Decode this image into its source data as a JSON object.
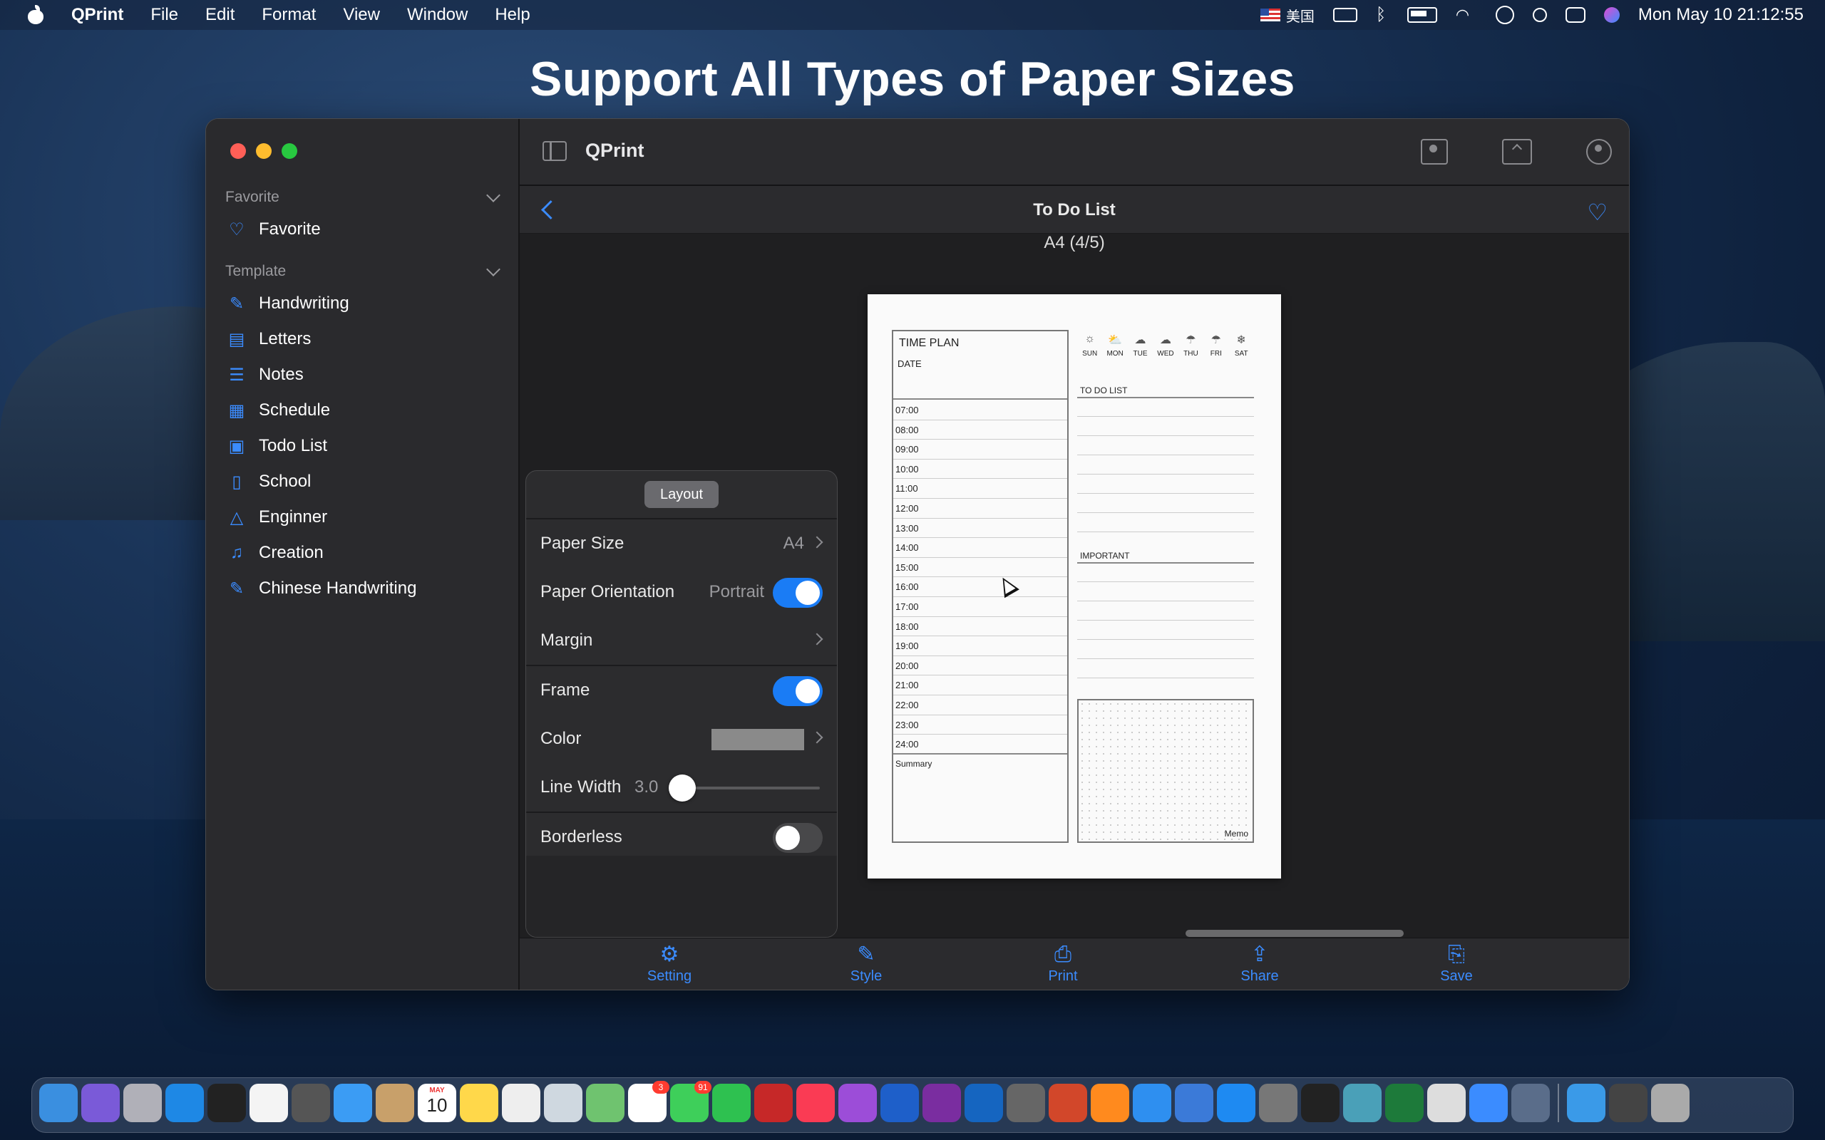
{
  "menubar": {
    "app_name": "QPrint",
    "menus": [
      "File",
      "Edit",
      "Format",
      "View",
      "Window",
      "Help"
    ],
    "input_method": "美国",
    "clock": "Mon May 10  21:12:55"
  },
  "headline": "Support All Types of Paper Sizes",
  "window": {
    "title": "QPrint",
    "sidebar": {
      "favorite_header": "Favorite",
      "favorite_items": [
        {
          "label": "Favorite",
          "icon": "heart-icon"
        }
      ],
      "template_header": "Template",
      "template_items": [
        {
          "label": "Handwriting",
          "icon": "pen-circle-icon"
        },
        {
          "label": "Letters",
          "icon": "newspaper-icon"
        },
        {
          "label": "Notes",
          "icon": "lines-icon"
        },
        {
          "label": "Schedule",
          "icon": "table-icon"
        },
        {
          "label": "Todo List",
          "icon": "list-box-icon"
        },
        {
          "label": "School",
          "icon": "book-icon"
        },
        {
          "label": "Enginner",
          "icon": "triangle-ruler-icon"
        },
        {
          "label": "Creation",
          "icon": "music-note-icon"
        },
        {
          "label": "Chinese Handwriting",
          "icon": "pen-circle-icon"
        }
      ]
    },
    "nav": {
      "title": "To Do List"
    },
    "page_label": "A4 (4/5)",
    "paper": {
      "time_plan_title": "TIME PLAN",
      "date_label": "DATE",
      "hours": [
        "07:00",
        "08:00",
        "09:00",
        "10:00",
        "11:00",
        "12:00",
        "13:00",
        "14:00",
        "15:00",
        "16:00",
        "17:00",
        "18:00",
        "19:00",
        "20:00",
        "21:00",
        "22:00",
        "23:00",
        "24:00"
      ],
      "summary_label": "Summary",
      "days": [
        "SUN",
        "MON",
        "TUE",
        "WED",
        "THU",
        "FRI",
        "SAT"
      ],
      "todo_label": "TO DO LIST",
      "important_label": "IMPORTANT",
      "memo_label": "Memo"
    },
    "popover": {
      "tab_label": "Layout",
      "paper_size_label": "Paper Size",
      "paper_size_value": "A4",
      "orientation_label": "Paper Orientation",
      "orientation_value": "Portrait",
      "orientation_on": true,
      "margin_label": "Margin",
      "frame_label": "Frame",
      "frame_on": true,
      "color_label": "Color",
      "color_value": "#8a8a8a",
      "line_width_label": "Line Width",
      "line_width_value": "3.0",
      "borderless_label": "Borderless",
      "borderless_on": false
    },
    "tabbar": [
      {
        "label": "Setting",
        "icon": "gear-icon"
      },
      {
        "label": "Style",
        "icon": "pencil-circle-icon"
      },
      {
        "label": "Print",
        "icon": "printer-icon"
      },
      {
        "label": "Share",
        "icon": "share-icon"
      },
      {
        "label": "Save",
        "icon": "save-doc-icon"
      }
    ]
  },
  "colors": {
    "accent": "#3b8cff",
    "toggle_on": "#1a7cf5"
  },
  "dock": {
    "apps": [
      "Finder",
      "Siri",
      "Launchpad",
      "Safari",
      "Activity Monitor",
      "Chrome",
      "Calculator",
      "Mail",
      "Contacts",
      "Calendar",
      "Notes",
      "TextEdit",
      "Preview",
      "Maps",
      "Photos",
      "Messages",
      "FaceTime",
      "Photo Booth",
      "Music",
      "Podcasts",
      "Word",
      "OneNote",
      "Outlook",
      "Screenshot",
      "PowerPoint",
      "Books",
      "Find My",
      "Xcode",
      "App Store",
      "System Preferences",
      "Terminal",
      "Sequel",
      "Excel",
      "Storage",
      "Instruments",
      "Simulator",
      "Downloads",
      "Screenshots",
      "Trash"
    ],
    "calendar_month": "MAY",
    "calendar_day": "10",
    "badge_photos": "3",
    "badge_messages": "91"
  }
}
